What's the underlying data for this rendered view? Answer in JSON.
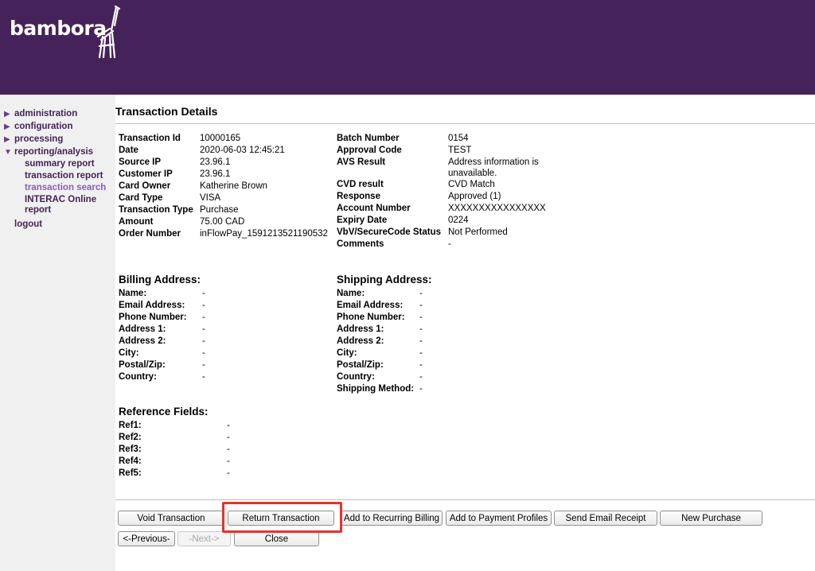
{
  "brand": {
    "logo_text": "bambora",
    "header_color": "#46225a",
    "accent_color": "#8a5cc4",
    "highlight_color": "#e3342f"
  },
  "nav": {
    "administration": "administration",
    "configuration": "configuration",
    "processing": "processing",
    "reporting": "reporting/analysis",
    "summary_report": "summary report",
    "transaction_report": "transaction report",
    "transaction_search": "transaction search",
    "interac_line1": "INTERAC Online",
    "interac_line2": "report",
    "logout": "logout"
  },
  "page": {
    "title": "Transaction Details"
  },
  "left_details": [
    {
      "label": "Transaction Id",
      "value": "10000165"
    },
    {
      "label": "Date",
      "value": "2020-06-03 12:45:21"
    },
    {
      "label": "Source IP",
      "value": "23.96.1"
    },
    {
      "label": "Customer IP",
      "value": "23.96.1"
    },
    {
      "label": "Card Owner",
      "value": "Katherine Brown"
    },
    {
      "label": "Card Type",
      "value": "VISA"
    },
    {
      "label": "Transaction Type",
      "value": "Purchase"
    },
    {
      "label": "Amount",
      "value": "75.00 CAD"
    },
    {
      "label": "Order Number",
      "value": "inFlowPay_1591213521190532"
    }
  ],
  "right_details": {
    "batch_label": "Batch Number",
    "batch_value": "0154",
    "approval_label": "Approval Code",
    "approval_value": "TEST",
    "avs_label": "AVS Result",
    "avs_value_line1": "Address information is",
    "avs_value_line2": "unavailable.",
    "cvd_label": "CVD result",
    "cvd_value": "CVD Match",
    "response_label": "Response",
    "response_value": "Approved (1)",
    "account_label": "Account Number",
    "account_value": "XXXXXXXXXXXXXXXX",
    "expiry_label": "Expiry Date",
    "expiry_value": "0224",
    "vbv_label": "VbV/SecureCode Status",
    "vbv_value": "Not Performed",
    "comments_label": "Comments",
    "comments_value": "-"
  },
  "billing": {
    "title": "Billing Address:",
    "rows": [
      {
        "label": "Name:",
        "value": "-"
      },
      {
        "label": "Email Address:",
        "value": "-"
      },
      {
        "label": "Phone Number:",
        "value": "-"
      },
      {
        "label": "Address 1:",
        "value": "-"
      },
      {
        "label": "Address 2:",
        "value": "-"
      },
      {
        "label": "City:",
        "value": "-"
      },
      {
        "label": "Postal/Zip:",
        "value": "-"
      },
      {
        "label": "Country:",
        "value": "-"
      }
    ]
  },
  "shipping": {
    "title": "Shipping Address:",
    "rows": [
      {
        "label": "Name:",
        "value": "-"
      },
      {
        "label": "Email Address:",
        "value": "-"
      },
      {
        "label": "Phone Number:",
        "value": "-"
      },
      {
        "label": "Address 1:",
        "value": "-"
      },
      {
        "label": "Address 2:",
        "value": "-"
      },
      {
        "label": "City:",
        "value": "-"
      },
      {
        "label": "Postal/Zip:",
        "value": "-"
      },
      {
        "label": "Country:",
        "value": "-"
      },
      {
        "label": "Shipping Method:",
        "value": "-"
      }
    ]
  },
  "reference": {
    "title": "Reference Fields:",
    "rows": [
      {
        "label": "Ref1:",
        "value": "-"
      },
      {
        "label": "Ref2:",
        "value": "-"
      },
      {
        "label": "Ref3:",
        "value": "-"
      },
      {
        "label": "Ref4:",
        "value": "-"
      },
      {
        "label": "Ref5:",
        "value": "-"
      }
    ]
  },
  "buttons": {
    "void": "Void Transaction",
    "return": "Return Transaction",
    "recurring": "Add to Recurring Billing",
    "payment_profiles": "Add to Payment Profiles",
    "email_receipt": "Send Email Receipt",
    "new_purchase": "New Purchase",
    "previous": "<-Previous-",
    "next": "-Next->",
    "close": "Close"
  }
}
